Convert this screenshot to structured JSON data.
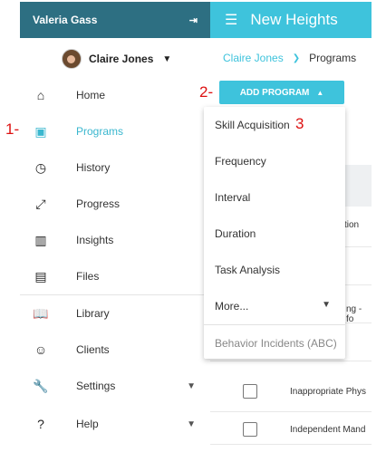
{
  "sidebar": {
    "account_name": "Valeria Gass",
    "user_name": "Claire Jones",
    "items": [
      {
        "label": "Home",
        "icon": "home-icon",
        "glyph": "⌂"
      },
      {
        "label": "Programs",
        "icon": "programs-icon",
        "glyph": "▣"
      },
      {
        "label": "History",
        "icon": "clock-icon",
        "glyph": "◷"
      },
      {
        "label": "Progress",
        "icon": "trend-icon",
        "glyph": "⤢"
      },
      {
        "label": "Insights",
        "icon": "bar-chart-icon",
        "glyph": "▥"
      },
      {
        "label": "Files",
        "icon": "file-icon",
        "glyph": "▤"
      },
      {
        "label": "Library",
        "icon": "book-reader-icon",
        "glyph": "📖"
      },
      {
        "label": "Clients",
        "icon": "face-icon",
        "glyph": "☺"
      },
      {
        "label": "Settings",
        "icon": "wrench-icon",
        "glyph": "🔧"
      },
      {
        "label": "Help",
        "icon": "help-icon",
        "glyph": "?"
      }
    ]
  },
  "header": {
    "title": "New Heights"
  },
  "breadcrumb": {
    "parent": "Claire Jones",
    "current": "Programs"
  },
  "add_program": {
    "label": "ADD PROGRAM"
  },
  "dropdown": {
    "items": [
      "Skill Acquisition",
      "Frequency",
      "Interval",
      "Duration",
      "Task Analysis",
      "More...",
      "Behavior Incidents (ABC)"
    ]
  },
  "table": {
    "row_partial_1": "tion",
    "row_partial_2": "ng - fo",
    "row_a": "Inappropriate Phys",
    "row_b": "Independent Mand"
  },
  "annotations": {
    "a1": "1-",
    "a2": "2-",
    "a3": "3"
  },
  "colors": {
    "accent": "#3ec3dc",
    "sidebar_header": "#2d6f82",
    "annotation": "#dd1111"
  }
}
